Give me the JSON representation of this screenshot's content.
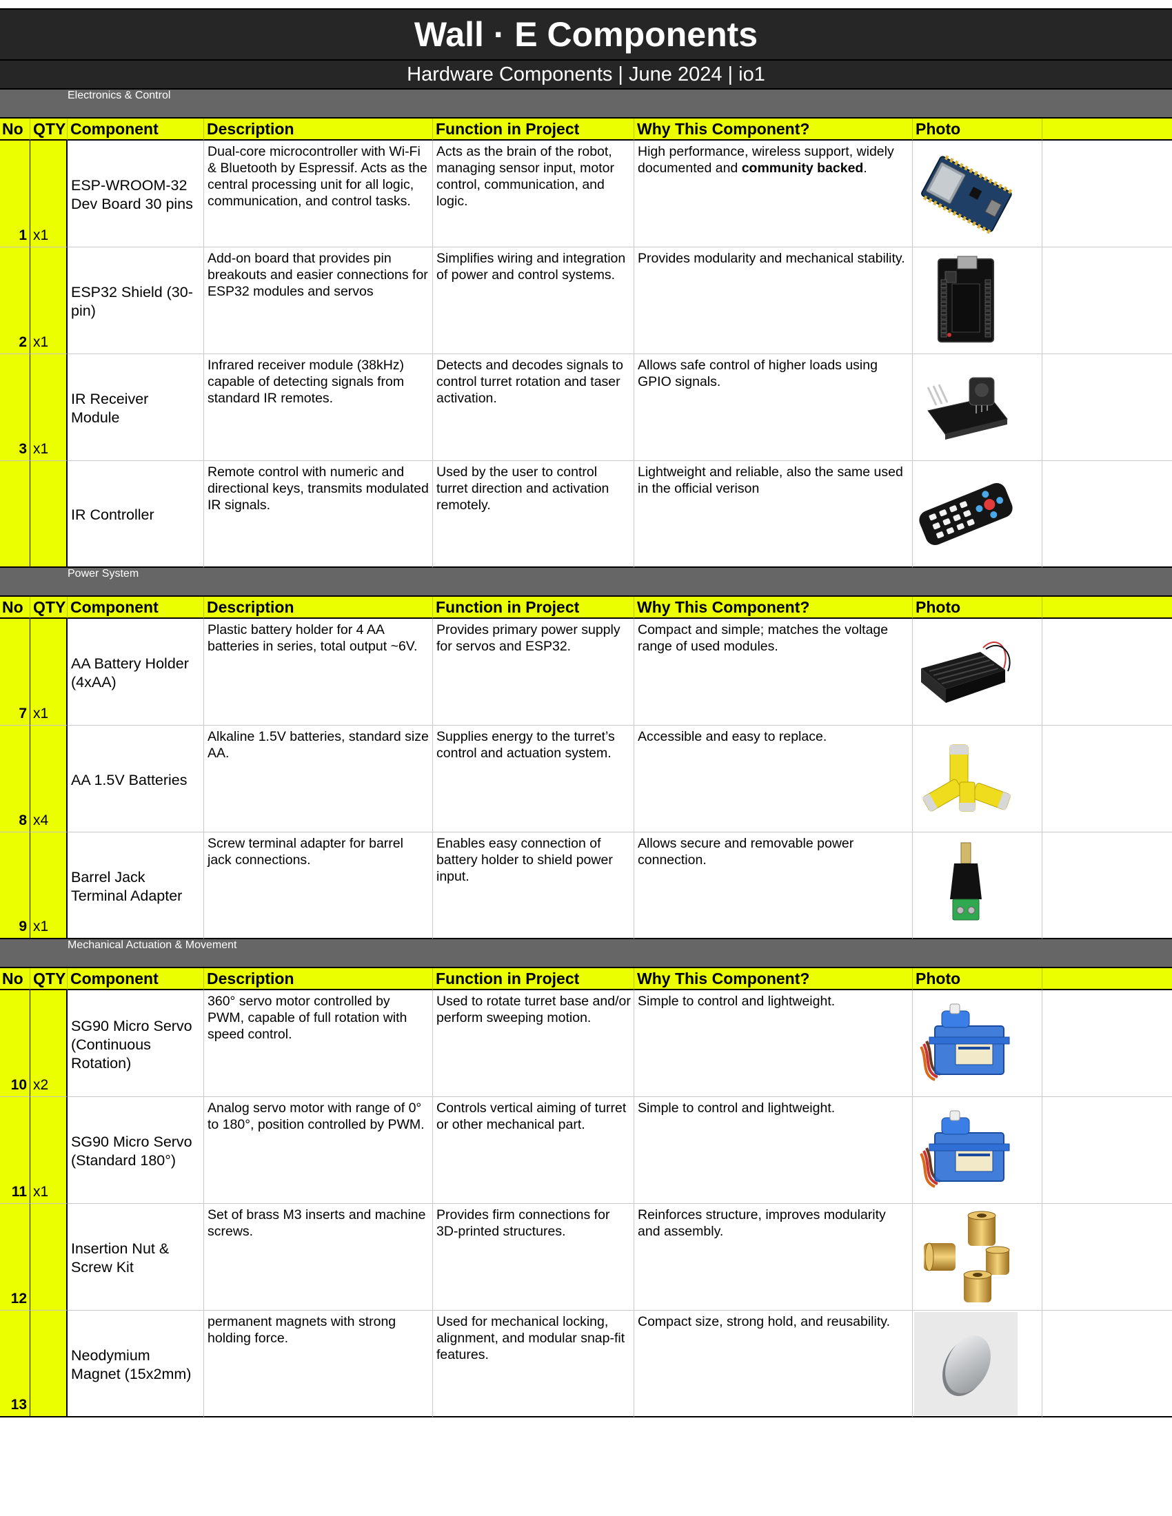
{
  "title": "Wall · E Components",
  "subtitle": "Hardware Components | June 2024 | io1",
  "headers": {
    "no": "No",
    "qty": "QTY",
    "component": "Component",
    "description": "Description",
    "function": "Function in Project",
    "why": "Why This Component?",
    "photo": "Photo"
  },
  "sections": [
    {
      "title": "Electronics & Control",
      "rows": [
        {
          "no": "1",
          "qty": "x1",
          "component": "ESP-WROOM-32 Dev Board 30 pins",
          "description": "Dual-core microcontroller with Wi-Fi & Bluetooth by Espressif. Acts as the central processing unit for all logic, communication, and control tasks.",
          "function": "Acts as the brain of the robot, managing sensor input, motor control, communication, and logic.",
          "why_pre": "High performance, wireless support, widely documented and ",
          "why_bold": "community backed",
          "why_post": ".",
          "photo": "esp32-board"
        },
        {
          "no": "2",
          "qty": "x1",
          "component": "ESP32 Shield (30-pin)",
          "description": "Add-on board that provides pin breakouts and easier connections for ESP32 modules and servos",
          "function": "Simplifies wiring and integration of power and control systems.",
          "why_pre": "Provides modularity and mechanical stability.",
          "why_bold": "",
          "why_post": "",
          "photo": "esp32-shield"
        },
        {
          "no": "3",
          "qty": "x1",
          "component": "IR Receiver Module",
          "description": "Infrared receiver module (38kHz) capable of detecting signals from standard IR remotes.",
          "function": "Detects and decodes signals to control turret rotation and taser activation.",
          "why_pre": "Allows safe control of higher loads using GPIO signals.",
          "why_bold": "",
          "why_post": "",
          "photo": "ir-receiver"
        },
        {
          "no": "",
          "qty": "",
          "component": "IR Controller",
          "description": "Remote control with numeric and directional keys, transmits modulated IR signals.",
          "function": "Used by the user to control turret direction and activation remotely.",
          "why_pre": "Lightweight and reliable, also the same used in the official verison",
          "why_bold": "",
          "why_post": "",
          "photo": "ir-remote"
        }
      ]
    },
    {
      "title": "Power System",
      "rows": [
        {
          "no": "7",
          "qty": "x1",
          "component": "AA Battery Holder (4xAA)",
          "description": "Plastic battery holder for 4 AA batteries in series, total output ~6V.",
          "function": "Provides primary power supply for servos and ESP32.",
          "why_pre": "Compact and simple; matches the voltage range of used modules.",
          "why_bold": "",
          "why_post": "",
          "photo": "battery-holder"
        },
        {
          "no": "8",
          "qty": "x4",
          "component": "AA 1.5V Batteries",
          "description": "Alkaline 1.5V batteries, standard size AA.",
          "function": "Supplies energy to the turret’s control and actuation system.",
          "why_pre": "Accessible and easy to replace.",
          "why_bold": "",
          "why_post": "",
          "photo": "batteries"
        },
        {
          "no": "9",
          "qty": "x1",
          "component": "Barrel Jack Terminal Adapter",
          "description": "Screw terminal adapter for barrel jack connections.",
          "function": "Enables easy connection of battery holder to shield power input.",
          "why_pre": "Allows secure and removable power connection.",
          "why_bold": "",
          "why_post": "",
          "photo": "barrel-jack"
        }
      ]
    },
    {
      "title": "Mechanical Actuation & Movement",
      "rows": [
        {
          "no": "10",
          "qty": "x2",
          "component": "SG90 Micro Servo (Continuous Rotation)",
          "description": "360° servo motor controlled by PWM, capable of full rotation with speed control.",
          "function": "Used to rotate turret base and/or perform sweeping motion.",
          "why_pre": "Simple to control and lightweight.",
          "why_bold": "",
          "why_post": "",
          "photo": "servo"
        },
        {
          "no": "11",
          "qty": "x1",
          "component": "SG90 Micro Servo (Standard 180°)",
          "description": "Analog servo motor with range of 0° to 180°, position controlled by PWM.",
          "function": "Controls vertical aiming of turret or other mechanical part.",
          "why_pre": "Simple to control and lightweight.",
          "why_bold": "",
          "why_post": "",
          "photo": "servo"
        },
        {
          "no": "12",
          "qty": "",
          "component": "Insertion Nut & Screw Kit",
          "description": "Set of brass M3 inserts and machine screws.",
          "function": "Provides firm connections for 3D-printed structures.",
          "why_pre": "Reinforces structure, improves modularity and assembly.",
          "why_bold": "",
          "why_post": "",
          "photo": "brass-inserts"
        },
        {
          "no": "13",
          "qty": "",
          "component": "Neodymium Magnet (15x2mm)",
          "description": "permanent magnets with strong holding force.",
          "function": "Used for mechanical locking, alignment, and modular snap-fit features.",
          "why_pre": "Compact size, strong hold, and reusability.",
          "why_bold": "",
          "why_post": "",
          "photo": "magnet"
        }
      ]
    }
  ]
}
